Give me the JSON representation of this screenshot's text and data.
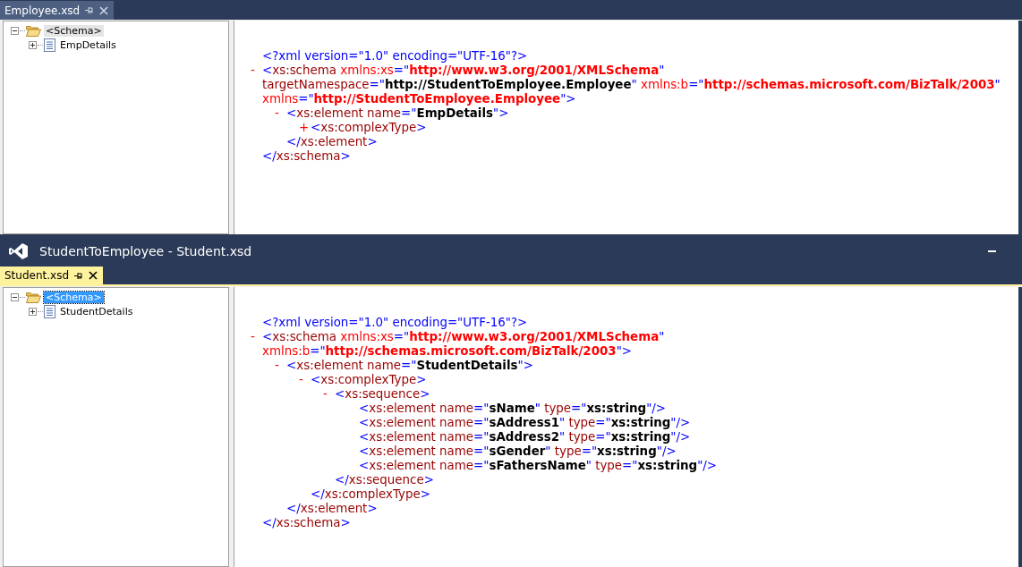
{
  "documents": [
    {
      "tab": {
        "label": "Employee.xsd",
        "active": false
      },
      "tree": [
        {
          "label": "<Schema>",
          "kind": "folder",
          "selected": true,
          "expanded": true,
          "children": [
            {
              "label": "EmpDetails",
              "kind": "record",
              "selected": false,
              "expanded": false
            }
          ]
        }
      ],
      "xml": [
        {
          "open": [
            [
              {
                "t": "<?xml version=\"1.0\" encoding=\"UTF-16\"?>",
                "kind": "m"
              }
            ]
          ]
        },
        {
          "toggle": "-",
          "open": [
            [
              {
                "t": "<",
                "kind": "m"
              },
              {
                "t": "xs:schema",
                "kind": "tag"
              },
              {
                "t": " xmlns:xs",
                "kind": "ns"
              },
              {
                "t": "=\"",
                "kind": "m"
              },
              {
                "t": "http://www.w3.org/2001/XMLSchema",
                "kind": "nsval"
              },
              {
                "t": "\"",
                "kind": "m"
              }
            ],
            [
              {
                "t": "targetNamespace",
                "kind": "attr"
              },
              {
                "t": "=\"",
                "kind": "m"
              },
              {
                "t": "http://StudentToEmployee.Employee",
                "kind": "val"
              },
              {
                "t": "\"",
                "kind": "m"
              },
              {
                "t": " xmlns:b",
                "kind": "ns"
              },
              {
                "t": "=\"",
                "kind": "m"
              },
              {
                "t": "http://schemas.microsoft.com/BizTalk/2003",
                "kind": "nsval"
              },
              {
                "t": "\"",
                "kind": "m"
              }
            ],
            [
              {
                "t": "xmlns",
                "kind": "ns"
              },
              {
                "t": "=\"",
                "kind": "m"
              },
              {
                "t": "http://StudentToEmployee.Employee",
                "kind": "nsval"
              },
              {
                "t": "\">",
                "kind": "m"
              }
            ]
          ],
          "children": [
            {
              "toggle": "-",
              "open": [
                [
                  {
                    "t": "<",
                    "kind": "m"
                  },
                  {
                    "t": "xs:element name",
                    "kind": "tag"
                  },
                  {
                    "t": "=\"",
                    "kind": "m"
                  },
                  {
                    "t": "EmpDetails",
                    "kind": "val"
                  },
                  {
                    "t": "\">",
                    "kind": "m"
                  }
                ]
              ],
              "children": [
                {
                  "toggle": "+",
                  "open": [
                    [
                      {
                        "t": "<",
                        "kind": "m"
                      },
                      {
                        "t": "xs:complexType",
                        "kind": "tag"
                      },
                      {
                        "t": ">",
                        "kind": "m"
                      }
                    ]
                  ]
                }
              ],
              "close": [
                {
                  "t": "</",
                  "kind": "m"
                },
                {
                  "t": "xs:element",
                  "kind": "tag"
                },
                {
                  "t": ">",
                  "kind": "m"
                }
              ]
            }
          ],
          "close": [
            {
              "t": "</",
              "kind": "m"
            },
            {
              "t": "xs:schema",
              "kind": "tag"
            },
            {
              "t": ">",
              "kind": "m"
            }
          ]
        }
      ]
    },
    {
      "window": {
        "title": "StudentToEmployee - Student.xsd"
      },
      "tab": {
        "label": "Student.xsd",
        "active": true
      },
      "tree": [
        {
          "label": "<Schema>",
          "kind": "folder",
          "selected": true,
          "expanded": true,
          "children": [
            {
              "label": "StudentDetails",
              "kind": "record",
              "selected": false,
              "expanded": false
            }
          ]
        }
      ],
      "xml": [
        {
          "open": [
            [
              {
                "t": "<?xml version=\"1.0\" encoding=\"UTF-16\"?>",
                "kind": "m"
              }
            ]
          ]
        },
        {
          "toggle": "-",
          "open": [
            [
              {
                "t": "<",
                "kind": "m"
              },
              {
                "t": "xs:schema",
                "kind": "tag"
              },
              {
                "t": " xmlns:xs",
                "kind": "ns"
              },
              {
                "t": "=\"",
                "kind": "m"
              },
              {
                "t": "http://www.w3.org/2001/XMLSchema",
                "kind": "nsval"
              },
              {
                "t": "\"",
                "kind": "m"
              }
            ],
            [
              {
                "t": "xmlns:b",
                "kind": "ns"
              },
              {
                "t": "=\"",
                "kind": "m"
              },
              {
                "t": "http://schemas.microsoft.com/BizTalk/2003",
                "kind": "nsval"
              },
              {
                "t": "\">",
                "kind": "m"
              }
            ]
          ],
          "children": [
            {
              "toggle": "-",
              "open": [
                [
                  {
                    "t": "<",
                    "kind": "m"
                  },
                  {
                    "t": "xs:element name",
                    "kind": "tag"
                  },
                  {
                    "t": "=\"",
                    "kind": "m"
                  },
                  {
                    "t": "StudentDetails",
                    "kind": "val"
                  },
                  {
                    "t": "\">",
                    "kind": "m"
                  }
                ]
              ],
              "children": [
                {
                  "toggle": "-",
                  "open": [
                    [
                      {
                        "t": "<",
                        "kind": "m"
                      },
                      {
                        "t": "xs:complexType",
                        "kind": "tag"
                      },
                      {
                        "t": ">",
                        "kind": "m"
                      }
                    ]
                  ],
                  "children": [
                    {
                      "toggle": "-",
                      "open": [
                        [
                          {
                            "t": "<",
                            "kind": "m"
                          },
                          {
                            "t": "xs:sequence",
                            "kind": "tag"
                          },
                          {
                            "t": ">",
                            "kind": "m"
                          }
                        ]
                      ],
                      "children": [
                        {
                          "open": [
                            [
                              {
                                "t": "<",
                                "kind": "m"
                              },
                              {
                                "t": "xs:element name",
                                "kind": "tag"
                              },
                              {
                                "t": "=\"",
                                "kind": "m"
                              },
                              {
                                "t": "sName",
                                "kind": "val"
                              },
                              {
                                "t": "\"",
                                "kind": "m"
                              },
                              {
                                "t": " type",
                                "kind": "attr"
                              },
                              {
                                "t": "=\"",
                                "kind": "m"
                              },
                              {
                                "t": "xs:string",
                                "kind": "val"
                              },
                              {
                                "t": "\"/>",
                                "kind": "m"
                              }
                            ]
                          ]
                        },
                        {
                          "open": [
                            [
                              {
                                "t": "<",
                                "kind": "m"
                              },
                              {
                                "t": "xs:element name",
                                "kind": "tag"
                              },
                              {
                                "t": "=\"",
                                "kind": "m"
                              },
                              {
                                "t": "sAddress1",
                                "kind": "val"
                              },
                              {
                                "t": "\"",
                                "kind": "m"
                              },
                              {
                                "t": " type",
                                "kind": "attr"
                              },
                              {
                                "t": "=\"",
                                "kind": "m"
                              },
                              {
                                "t": "xs:string",
                                "kind": "val"
                              },
                              {
                                "t": "\"/>",
                                "kind": "m"
                              }
                            ]
                          ]
                        },
                        {
                          "open": [
                            [
                              {
                                "t": "<",
                                "kind": "m"
                              },
                              {
                                "t": "xs:element name",
                                "kind": "tag"
                              },
                              {
                                "t": "=\"",
                                "kind": "m"
                              },
                              {
                                "t": "sAddress2",
                                "kind": "val"
                              },
                              {
                                "t": "\"",
                                "kind": "m"
                              },
                              {
                                "t": " type",
                                "kind": "attr"
                              },
                              {
                                "t": "=\"",
                                "kind": "m"
                              },
                              {
                                "t": "xs:string",
                                "kind": "val"
                              },
                              {
                                "t": "\"/>",
                                "kind": "m"
                              }
                            ]
                          ]
                        },
                        {
                          "open": [
                            [
                              {
                                "t": "<",
                                "kind": "m"
                              },
                              {
                                "t": "xs:element name",
                                "kind": "tag"
                              },
                              {
                                "t": "=\"",
                                "kind": "m"
                              },
                              {
                                "t": "sGender",
                                "kind": "val"
                              },
                              {
                                "t": "\"",
                                "kind": "m"
                              },
                              {
                                "t": " type",
                                "kind": "attr"
                              },
                              {
                                "t": "=\"",
                                "kind": "m"
                              },
                              {
                                "t": "xs:string",
                                "kind": "val"
                              },
                              {
                                "t": "\"/>",
                                "kind": "m"
                              }
                            ]
                          ]
                        },
                        {
                          "open": [
                            [
                              {
                                "t": "<",
                                "kind": "m"
                              },
                              {
                                "t": "xs:element name",
                                "kind": "tag"
                              },
                              {
                                "t": "=\"",
                                "kind": "m"
                              },
                              {
                                "t": "sFathersName",
                                "kind": "val"
                              },
                              {
                                "t": "\"",
                                "kind": "m"
                              },
                              {
                                "t": " type",
                                "kind": "attr"
                              },
                              {
                                "t": "=\"",
                                "kind": "m"
                              },
                              {
                                "t": "xs:string",
                                "kind": "val"
                              },
                              {
                                "t": "\"/>",
                                "kind": "m"
                              }
                            ]
                          ]
                        }
                      ],
                      "close": [
                        {
                          "t": "</",
                          "kind": "m"
                        },
                        {
                          "t": "xs:sequence",
                          "kind": "tag"
                        },
                        {
                          "t": ">",
                          "kind": "m"
                        }
                      ]
                    }
                  ],
                  "close": [
                    {
                      "t": "</",
                      "kind": "m"
                    },
                    {
                      "t": "xs:complexType",
                      "kind": "tag"
                    },
                    {
                      "t": ">",
                      "kind": "m"
                    }
                  ]
                }
              ],
              "close": [
                {
                  "t": "</",
                  "kind": "m"
                },
                {
                  "t": "xs:element",
                  "kind": "tag"
                },
                {
                  "t": ">",
                  "kind": "m"
                }
              ]
            }
          ],
          "close": [
            {
              "t": "</",
              "kind": "m"
            },
            {
              "t": "xs:schema",
              "kind": "tag"
            },
            {
              "t": ">",
              "kind": "m"
            }
          ]
        }
      ]
    }
  ]
}
